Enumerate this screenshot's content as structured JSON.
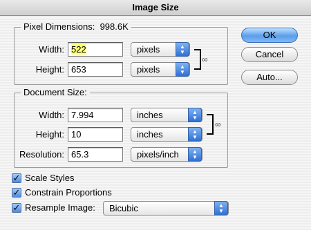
{
  "window": {
    "title": "Image Size"
  },
  "pixel_dimensions": {
    "label": "Pixel Dimensions:",
    "size": "998.6K",
    "width": {
      "label": "Width:",
      "value": "522",
      "unit": "pixels"
    },
    "height": {
      "label": "Height:",
      "value": "653",
      "unit": "pixels"
    }
  },
  "document_size": {
    "label": "Document Size:",
    "width": {
      "label": "Width:",
      "value": "7.994",
      "unit": "inches"
    },
    "height": {
      "label": "Height:",
      "value": "10",
      "unit": "inches"
    },
    "resolution": {
      "label": "Resolution:",
      "value": "65.3",
      "unit": "pixels/inch"
    }
  },
  "buttons": {
    "ok": "OK",
    "cancel": "Cancel",
    "auto": "Auto..."
  },
  "options": {
    "scale_styles": {
      "label": "Scale Styles",
      "checked": true
    },
    "constrain_proportions": {
      "label": "Constrain Proportions",
      "checked": true
    },
    "resample_image": {
      "label": "Resample Image:",
      "checked": true,
      "method": "Bicubic"
    }
  },
  "icons": {
    "chain": "chain-link-icon",
    "popup_arrows": "up-down-arrows-icon",
    "checkmark": "checkmark-icon"
  },
  "colors": {
    "selection": "#ffff7a",
    "accent": "#5c9eea"
  }
}
